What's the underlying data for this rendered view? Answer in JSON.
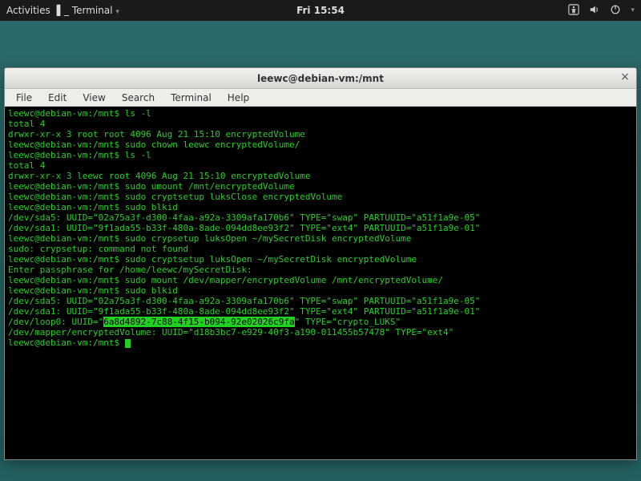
{
  "panel": {
    "activities": "Activities",
    "app_menu": "Terminal",
    "clock": "Fri 15:54"
  },
  "window": {
    "title": "leewc@debian-vm:/mnt",
    "menubar": [
      "File",
      "Edit",
      "View",
      "Search",
      "Terminal",
      "Help"
    ]
  },
  "terminal": {
    "prompt": "leewc@debian-vm:/mnt$",
    "lines": [
      {
        "t": "cmd",
        "cmd": "ls -l"
      },
      {
        "t": "out",
        "text": "total 4"
      },
      {
        "t": "out",
        "text": "drwxr-xr-x 3 root root 4096 Aug 21 15:10 encryptedVolume"
      },
      {
        "t": "cmd",
        "cmd": "sudo chown leewc encryptedVolume/"
      },
      {
        "t": "cmd",
        "cmd": "ls -l"
      },
      {
        "t": "out",
        "text": "total 4"
      },
      {
        "t": "out",
        "text": "drwxr-xr-x 3 leewc root 4096 Aug 21 15:10 encryptedVolume"
      },
      {
        "t": "cmd",
        "cmd": "sudo umount /mnt/encryptedVolume"
      },
      {
        "t": "cmd",
        "cmd": "sudo cryptsetup luksClose encryptedVolume"
      },
      {
        "t": "cmd",
        "cmd": "sudo blkid"
      },
      {
        "t": "out",
        "text": "/dev/sda5: UUID=\"02a75a3f-d300-4faa-a92a-3309afa170b6\" TYPE=\"swap\" PARTUUID=\"a51f1a9e-05\""
      },
      {
        "t": "out",
        "text": "/dev/sda1: UUID=\"9f1ada55-b33f-480a-8ade-094dd8ee93f2\" TYPE=\"ext4\" PARTUUID=\"a51f1a9e-01\""
      },
      {
        "t": "cmd",
        "cmd": "sudo crypsetup luksOpen ~/mySecretDisk encryptedVolume"
      },
      {
        "t": "out",
        "text": "sudo: crypsetup: command not found"
      },
      {
        "t": "cmd",
        "cmd": "sudo cryptsetup luksOpen ~/mySecretDisk encryptedVolume"
      },
      {
        "t": "out",
        "text": "Enter passphrase for /home/leewc/mySecretDisk:"
      },
      {
        "t": "cmd",
        "cmd": "sudo mount /dev/mapper/encryptedVolume /mnt/encryptedVolume/"
      },
      {
        "t": "cmd",
        "cmd": "sudo blkid"
      },
      {
        "t": "out",
        "text": "/dev/sda5: UUID=\"02a75a3f-d300-4faa-a92a-3309afa170b6\" TYPE=\"swap\" PARTUUID=\"a51f1a9e-05\""
      },
      {
        "t": "out",
        "text": "/dev/sda1: UUID=\"9f1ada55-b33f-480a-8ade-094dd8ee93f2\" TYPE=\"ext4\" PARTUUID=\"a51f1a9e-01\""
      },
      {
        "t": "hl",
        "pre": "/dev/loop0: UUID=\"",
        "hl": "6a8d4892-7c88-4f15-b094-92e02026c9fa",
        "post": "\" TYPE=\"crypto_LUKS\""
      },
      {
        "t": "out",
        "text": "/dev/mapper/encryptedVolume: UUID=\"d18b3bc7-e929-40f3-a190-011455b57478\" TYPE=\"ext4\""
      },
      {
        "t": "cursor"
      }
    ]
  }
}
